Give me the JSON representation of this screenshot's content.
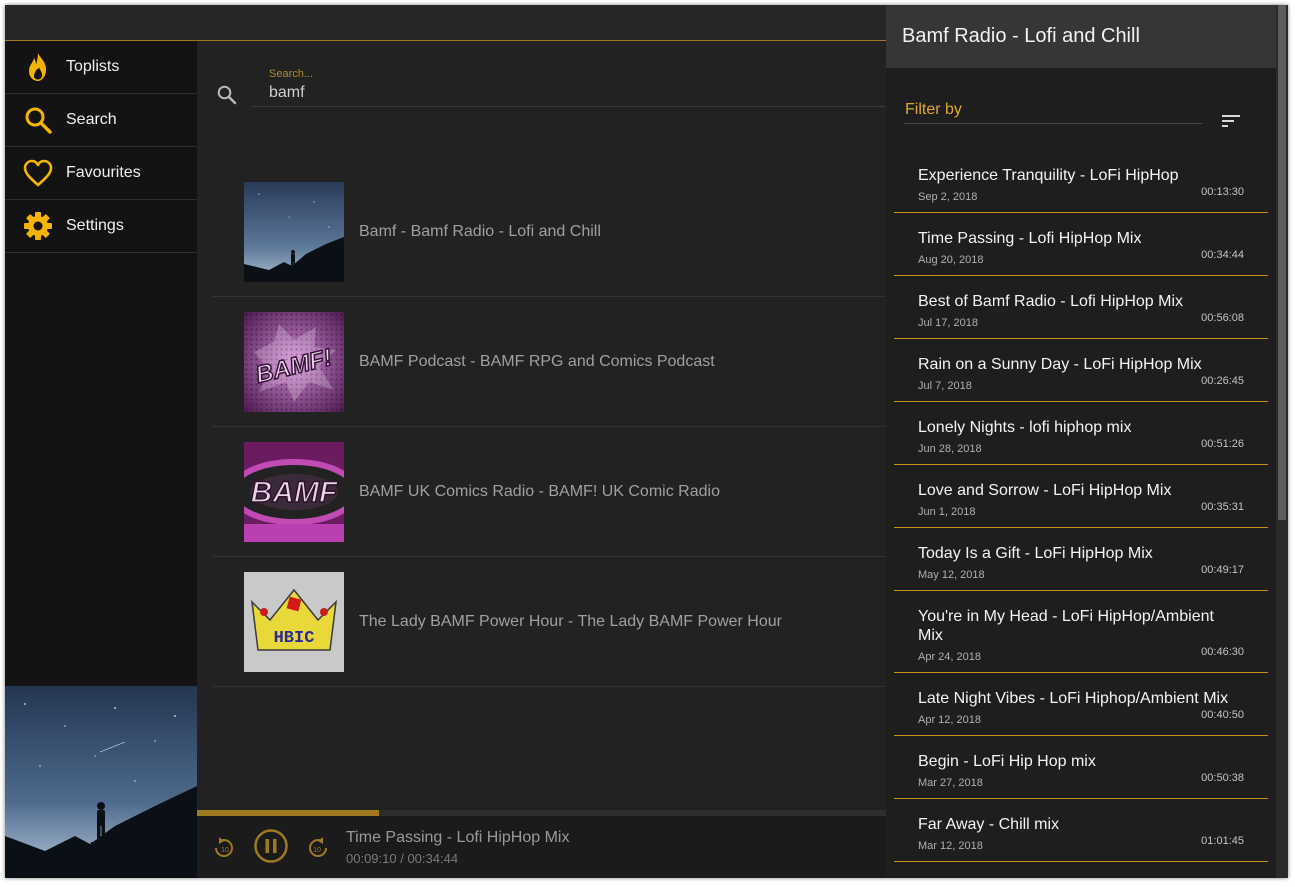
{
  "sidebar": {
    "items": [
      {
        "label": "Toplists",
        "icon": "flame-icon"
      },
      {
        "label": "Search",
        "icon": "search-icon"
      },
      {
        "label": "Favourites",
        "icon": "heart-icon"
      },
      {
        "label": "Settings",
        "icon": "gear-icon"
      }
    ],
    "accent": "#f5b400"
  },
  "search": {
    "label": "Search...",
    "value": "bamf"
  },
  "results": [
    {
      "title": "Bamf - Bamf Radio - Lofi and Chill"
    },
    {
      "title": "BAMF Podcast - BAMF RPG and Comics Podcast",
      "art_text": "BAMF!"
    },
    {
      "title": "BAMF UK Comics Radio - BAMF! UK Comic Radio",
      "art_text": "BAMF"
    },
    {
      "title": "The Lady BAMF Power Hour - The Lady BAMF Power Hour",
      "art_text": "HBIC"
    }
  ],
  "player": {
    "now_playing": "Time Passing - Lofi HipHop Mix",
    "time": "00:09:10 / 00:34:44",
    "progress": 0.2638,
    "rewind_label": "10",
    "forward_label": "10"
  },
  "panel": {
    "title": "Bamf Radio - Lofi and Chill",
    "filter_label": "Filter by",
    "episodes": [
      {
        "title": "Experience Tranquility - LoFi HipHop",
        "date": "Sep 2, 2018",
        "duration": "00:13:30"
      },
      {
        "title": "Time Passing - Lofi HipHop Mix",
        "date": "Aug 20, 2018",
        "duration": "00:34:44"
      },
      {
        "title": "Best of Bamf Radio - Lofi HipHop Mix",
        "date": "Jul 17, 2018",
        "duration": "00:56:08"
      },
      {
        "title": "Rain on a Sunny Day - LoFi HipHop Mix",
        "date": "Jul 7, 2018",
        "duration": "00:26:45"
      },
      {
        "title": "Lonely Nights - lofi hiphop mix",
        "date": "Jun 28, 2018",
        "duration": "00:51:26"
      },
      {
        "title": "Love and Sorrow - LoFi HipHop Mix",
        "date": "Jun 1, 2018",
        "duration": "00:35:31"
      },
      {
        "title": "Today Is a Gift - LoFi HipHop Mix",
        "date": "May 12, 2018",
        "duration": "00:49:17"
      },
      {
        "title": "You're in My Head - LoFi HipHop/Ambient Mix",
        "date": "Apr 24, 2018",
        "duration": "00:46:30"
      },
      {
        "title": "Late Night Vibes - LoFi Hiphop/Ambient Mix",
        "date": "Apr 12, 2018",
        "duration": "00:40:50"
      },
      {
        "title": "Begin - LoFi Hip Hop mix",
        "date": "Mar 27, 2018",
        "duration": "00:50:38"
      },
      {
        "title": "Far Away - Chill mix",
        "date": "Mar 12, 2018",
        "duration": "01:01:45"
      }
    ]
  }
}
